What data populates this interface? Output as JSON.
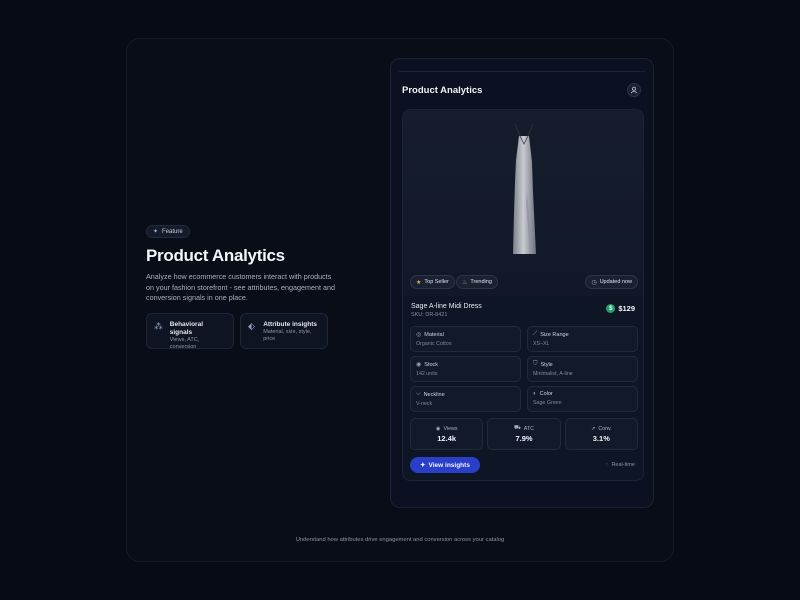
{
  "hero": {
    "chip": "Feature",
    "title": "Product Analytics",
    "description": "Analyze how ecommerce customers interact with products on your fashion storefront - see attributes, engagement and conversion signals in one place.",
    "cards": [
      {
        "icon": "sparkle-icon",
        "title": "Behavioral signals",
        "subtitle": "Views, ATC, conversion"
      },
      {
        "icon": "tag-icon",
        "title": "Attribute insights",
        "subtitle": "Material, size, style, price"
      }
    ]
  },
  "panel": {
    "title": "Product Analytics",
    "badges": {
      "top_seller": "Top Seller",
      "trending": "Trending",
      "updated": "Updated now"
    },
    "product": {
      "name": "Sage A-line Midi Dress",
      "sku": "SKU: DR-8421",
      "price": "$129"
    },
    "attributes": [
      {
        "icon": "material-icon",
        "label": "Material",
        "value": "Organic Cotton"
      },
      {
        "icon": "ruler-icon",
        "label": "Size Range",
        "value": "XS–XL"
      },
      {
        "icon": "box-icon",
        "label": "Stock",
        "value": "142 units"
      },
      {
        "icon": "shirt-icon",
        "label": "Style",
        "value": "Minimalist, A-line"
      },
      {
        "icon": "neckline-icon",
        "label": "Neckline",
        "value": "V-neck"
      },
      {
        "icon": "palette-icon",
        "label": "Color",
        "value": "Sage Green"
      }
    ],
    "stats": [
      {
        "icon": "eye-icon",
        "label": "Views",
        "value": "12.4k"
      },
      {
        "icon": "cart-icon",
        "label": "ATC",
        "value": "7.9%"
      },
      {
        "icon": "trend-icon",
        "label": "Conv.",
        "value": "3.1%"
      }
    ],
    "button": "View insights",
    "realtime": "Real-time"
  },
  "footer": "Understand how attributes drive engagement and conversion across your catalog"
}
